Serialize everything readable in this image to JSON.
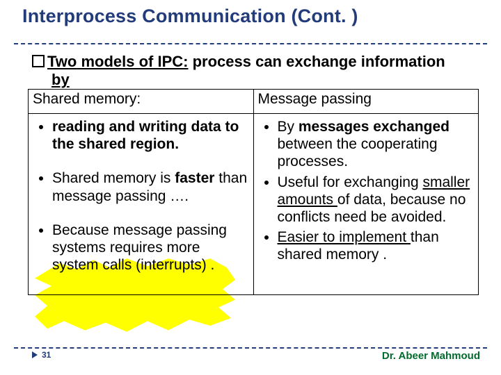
{
  "title": "Interprocess Communication (Cont. )",
  "intro": {
    "two": "Two",
    "models_of_ipc": " models of IPC:",
    "rest": " process can exchange information",
    "by": "by"
  },
  "table": {
    "left_header": "Shared memory:",
    "right_header": "Message passing",
    "left": {
      "b1_pre": "reading and writing data to the shared region.",
      "b2_a": "Shared memory is ",
      "b2_b": "faster",
      "b2_c": " than message passing ….",
      "b3": "Because message passing systems requires more system calls  (interrupts) ."
    },
    "right": {
      "b1_a": "By ",
      "b1_b": "messages exchanged",
      "b1_c": " between the cooperating processes.",
      "b2_a": "Useful for exchanging ",
      "b2_b": "smaller amounts ",
      "b2_c": "of data, because no conflicts need be avoided.",
      "b3_a": "Easier to implement ",
      "b3_b": "than shared memory ."
    }
  },
  "footer": {
    "page": "31",
    "author": "Dr. Abeer Mahmoud"
  }
}
